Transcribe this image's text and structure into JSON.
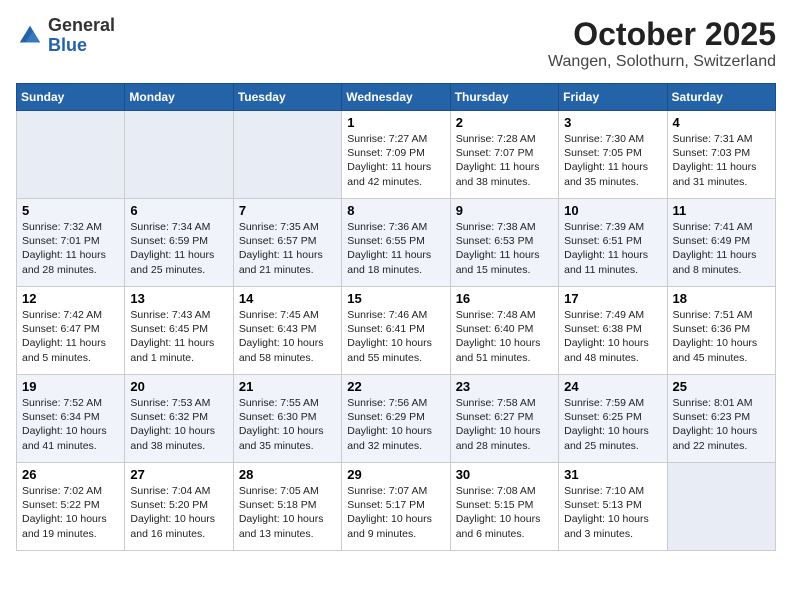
{
  "header": {
    "logo_general": "General",
    "logo_blue": "Blue",
    "title": "October 2025",
    "subtitle": "Wangen, Solothurn, Switzerland"
  },
  "weekdays": [
    "Sunday",
    "Monday",
    "Tuesday",
    "Wednesday",
    "Thursday",
    "Friday",
    "Saturday"
  ],
  "weeks": [
    [
      {
        "day": "",
        "info": ""
      },
      {
        "day": "",
        "info": ""
      },
      {
        "day": "",
        "info": ""
      },
      {
        "day": "1",
        "info": "Sunrise: 7:27 AM\nSunset: 7:09 PM\nDaylight: 11 hours and 42 minutes."
      },
      {
        "day": "2",
        "info": "Sunrise: 7:28 AM\nSunset: 7:07 PM\nDaylight: 11 hours and 38 minutes."
      },
      {
        "day": "3",
        "info": "Sunrise: 7:30 AM\nSunset: 7:05 PM\nDaylight: 11 hours and 35 minutes."
      },
      {
        "day": "4",
        "info": "Sunrise: 7:31 AM\nSunset: 7:03 PM\nDaylight: 11 hours and 31 minutes."
      }
    ],
    [
      {
        "day": "5",
        "info": "Sunrise: 7:32 AM\nSunset: 7:01 PM\nDaylight: 11 hours and 28 minutes."
      },
      {
        "day": "6",
        "info": "Sunrise: 7:34 AM\nSunset: 6:59 PM\nDaylight: 11 hours and 25 minutes."
      },
      {
        "day": "7",
        "info": "Sunrise: 7:35 AM\nSunset: 6:57 PM\nDaylight: 11 hours and 21 minutes."
      },
      {
        "day": "8",
        "info": "Sunrise: 7:36 AM\nSunset: 6:55 PM\nDaylight: 11 hours and 18 minutes."
      },
      {
        "day": "9",
        "info": "Sunrise: 7:38 AM\nSunset: 6:53 PM\nDaylight: 11 hours and 15 minutes."
      },
      {
        "day": "10",
        "info": "Sunrise: 7:39 AM\nSunset: 6:51 PM\nDaylight: 11 hours and 11 minutes."
      },
      {
        "day": "11",
        "info": "Sunrise: 7:41 AM\nSunset: 6:49 PM\nDaylight: 11 hours and 8 minutes."
      }
    ],
    [
      {
        "day": "12",
        "info": "Sunrise: 7:42 AM\nSunset: 6:47 PM\nDaylight: 11 hours and 5 minutes."
      },
      {
        "day": "13",
        "info": "Sunrise: 7:43 AM\nSunset: 6:45 PM\nDaylight: 11 hours and 1 minute."
      },
      {
        "day": "14",
        "info": "Sunrise: 7:45 AM\nSunset: 6:43 PM\nDaylight: 10 hours and 58 minutes."
      },
      {
        "day": "15",
        "info": "Sunrise: 7:46 AM\nSunset: 6:41 PM\nDaylight: 10 hours and 55 minutes."
      },
      {
        "day": "16",
        "info": "Sunrise: 7:48 AM\nSunset: 6:40 PM\nDaylight: 10 hours and 51 minutes."
      },
      {
        "day": "17",
        "info": "Sunrise: 7:49 AM\nSunset: 6:38 PM\nDaylight: 10 hours and 48 minutes."
      },
      {
        "day": "18",
        "info": "Sunrise: 7:51 AM\nSunset: 6:36 PM\nDaylight: 10 hours and 45 minutes."
      }
    ],
    [
      {
        "day": "19",
        "info": "Sunrise: 7:52 AM\nSunset: 6:34 PM\nDaylight: 10 hours and 41 minutes."
      },
      {
        "day": "20",
        "info": "Sunrise: 7:53 AM\nSunset: 6:32 PM\nDaylight: 10 hours and 38 minutes."
      },
      {
        "day": "21",
        "info": "Sunrise: 7:55 AM\nSunset: 6:30 PM\nDaylight: 10 hours and 35 minutes."
      },
      {
        "day": "22",
        "info": "Sunrise: 7:56 AM\nSunset: 6:29 PM\nDaylight: 10 hours and 32 minutes."
      },
      {
        "day": "23",
        "info": "Sunrise: 7:58 AM\nSunset: 6:27 PM\nDaylight: 10 hours and 28 minutes."
      },
      {
        "day": "24",
        "info": "Sunrise: 7:59 AM\nSunset: 6:25 PM\nDaylight: 10 hours and 25 minutes."
      },
      {
        "day": "25",
        "info": "Sunrise: 8:01 AM\nSunset: 6:23 PM\nDaylight: 10 hours and 22 minutes."
      }
    ],
    [
      {
        "day": "26",
        "info": "Sunrise: 7:02 AM\nSunset: 5:22 PM\nDaylight: 10 hours and 19 minutes."
      },
      {
        "day": "27",
        "info": "Sunrise: 7:04 AM\nSunset: 5:20 PM\nDaylight: 10 hours and 16 minutes."
      },
      {
        "day": "28",
        "info": "Sunrise: 7:05 AM\nSunset: 5:18 PM\nDaylight: 10 hours and 13 minutes."
      },
      {
        "day": "29",
        "info": "Sunrise: 7:07 AM\nSunset: 5:17 PM\nDaylight: 10 hours and 9 minutes."
      },
      {
        "day": "30",
        "info": "Sunrise: 7:08 AM\nSunset: 5:15 PM\nDaylight: 10 hours and 6 minutes."
      },
      {
        "day": "31",
        "info": "Sunrise: 7:10 AM\nSunset: 5:13 PM\nDaylight: 10 hours and 3 minutes."
      },
      {
        "day": "",
        "info": ""
      }
    ]
  ]
}
